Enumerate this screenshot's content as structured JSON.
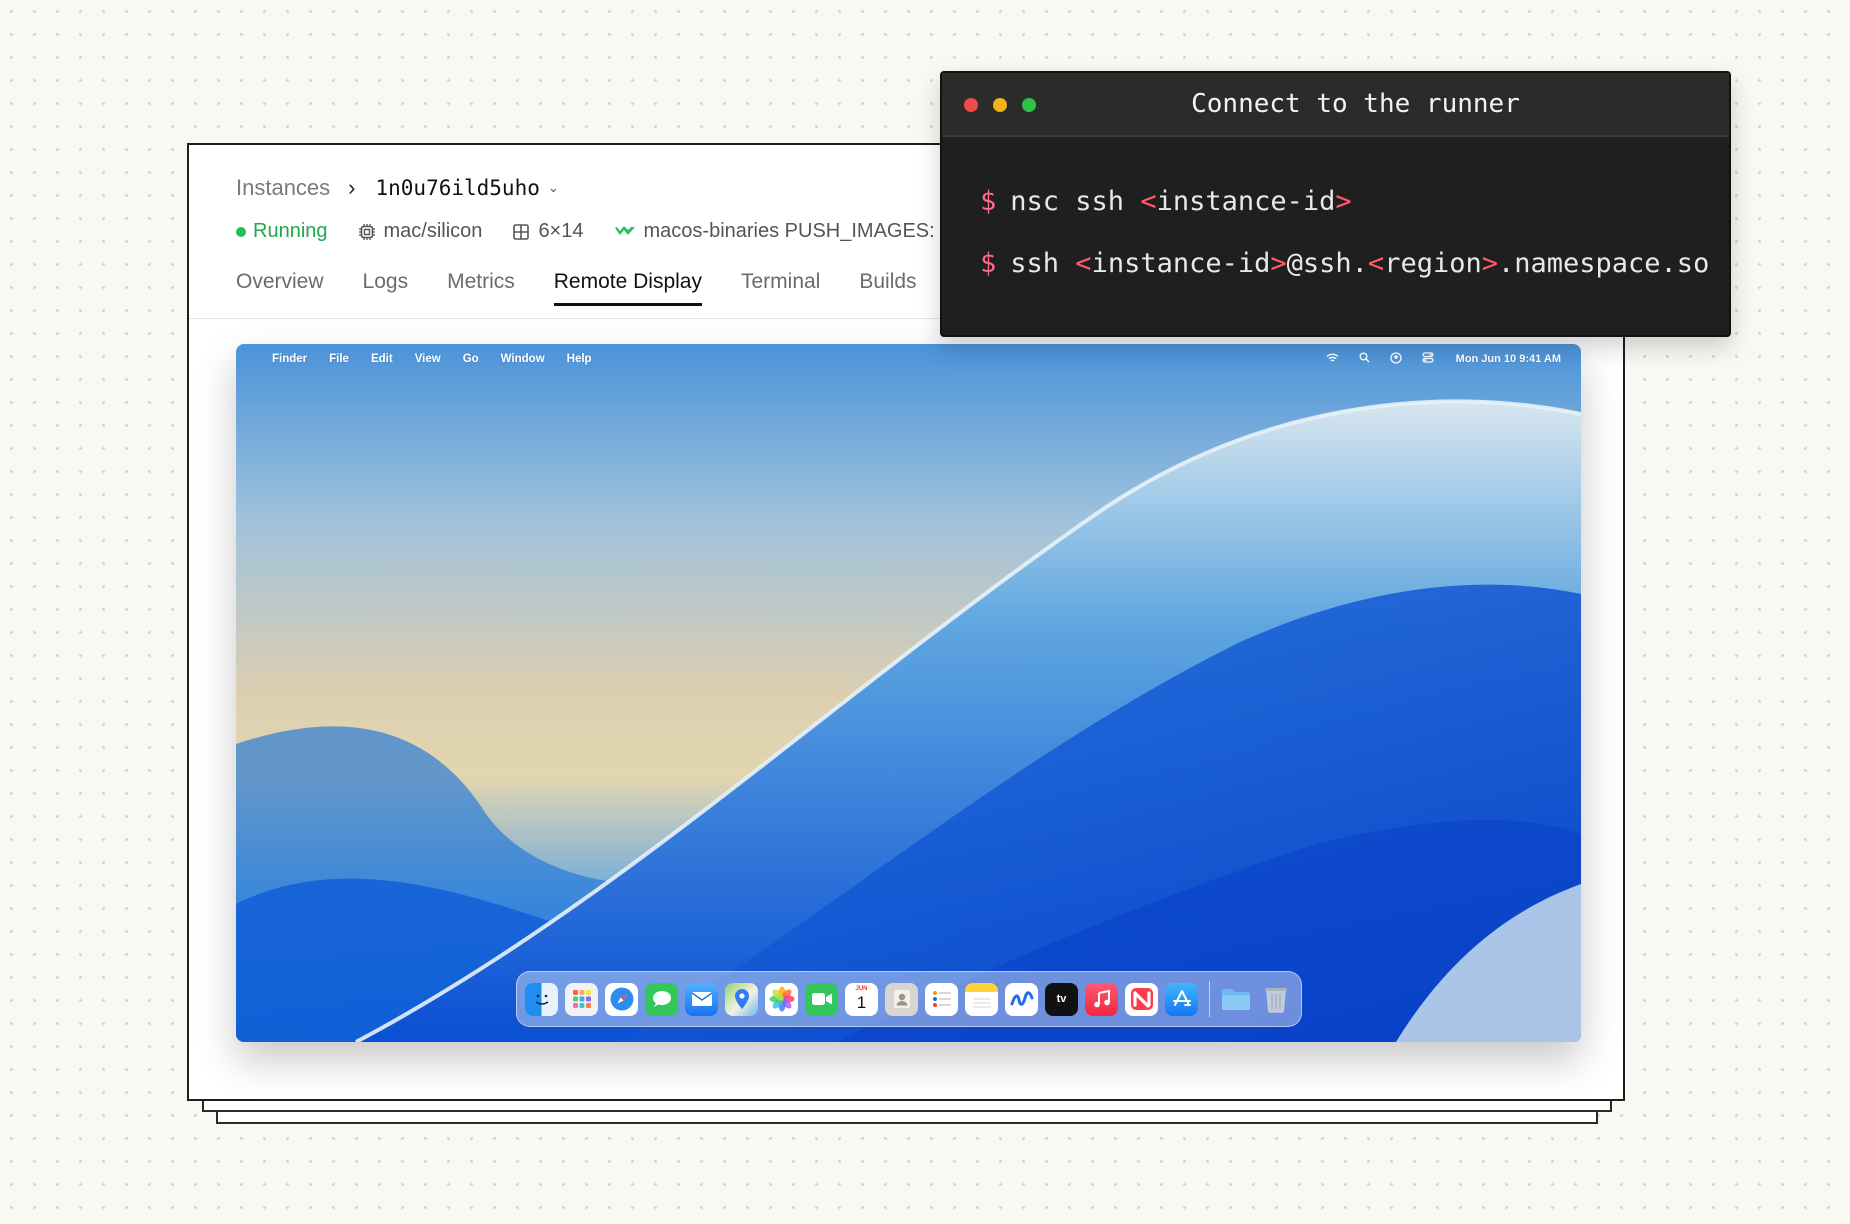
{
  "breadcrumb": {
    "parent": "Instances",
    "separator": "›",
    "instance_id": "1n0u76ild5uho",
    "chevron": "⌄"
  },
  "meta": {
    "status": "Running",
    "platform": "mac/silicon",
    "shape": "6×14",
    "image": "macos-binaries PUSH_IMAGES:"
  },
  "tabs": [
    {
      "label": "Overview",
      "active": false
    },
    {
      "label": "Logs",
      "active": false
    },
    {
      "label": "Metrics",
      "active": false
    },
    {
      "label": "Remote Display",
      "active": true
    },
    {
      "label": "Terminal",
      "active": false
    },
    {
      "label": "Builds",
      "active": false
    }
  ],
  "remote_display": {
    "menubar": {
      "apple": "",
      "items": [
        "Finder",
        "File",
        "Edit",
        "View",
        "Go",
        "Window",
        "Help"
      ],
      "clock": "Mon Jun 10  9:41 AM"
    },
    "dock": {
      "apps": [
        "finder-icon",
        "launchpad-icon",
        "safari-icon",
        "messages-icon",
        "mail-icon",
        "maps-icon",
        "photos-icon",
        "facetime-icon",
        "calendar-icon",
        "contacts-icon",
        "reminders-icon",
        "notes-icon",
        "freeform-icon",
        "appletv-icon",
        "music-icon",
        "news-icon",
        "appstore-icon"
      ],
      "calendar_day": "1",
      "calendar_month": "JUN",
      "tv_label": "tv",
      "extras": [
        "folder-icon",
        "trash-icon"
      ]
    }
  },
  "terminal": {
    "title": "Connect to the runner",
    "prompt": "$",
    "line1": {
      "cmd": "nsc ssh ",
      "lt": "<",
      "arg": "instance-id",
      "gt": ">"
    },
    "line2": {
      "cmd": "ssh ",
      "lt1": "<",
      "arg1": "instance-id",
      "gt1": ">",
      "mid": "@ssh.",
      "lt2": "<",
      "arg2": "region",
      "gt2": ">",
      "tail": ".namespace.so"
    }
  },
  "colors": {
    "running": "#21c15a",
    "terminal_bg": "#1f1f1f",
    "bracket": "#ff5a6e",
    "traffic_red": "#ee4b4b",
    "traffic_yellow": "#f2b21c",
    "traffic_green": "#2fc24b"
  }
}
